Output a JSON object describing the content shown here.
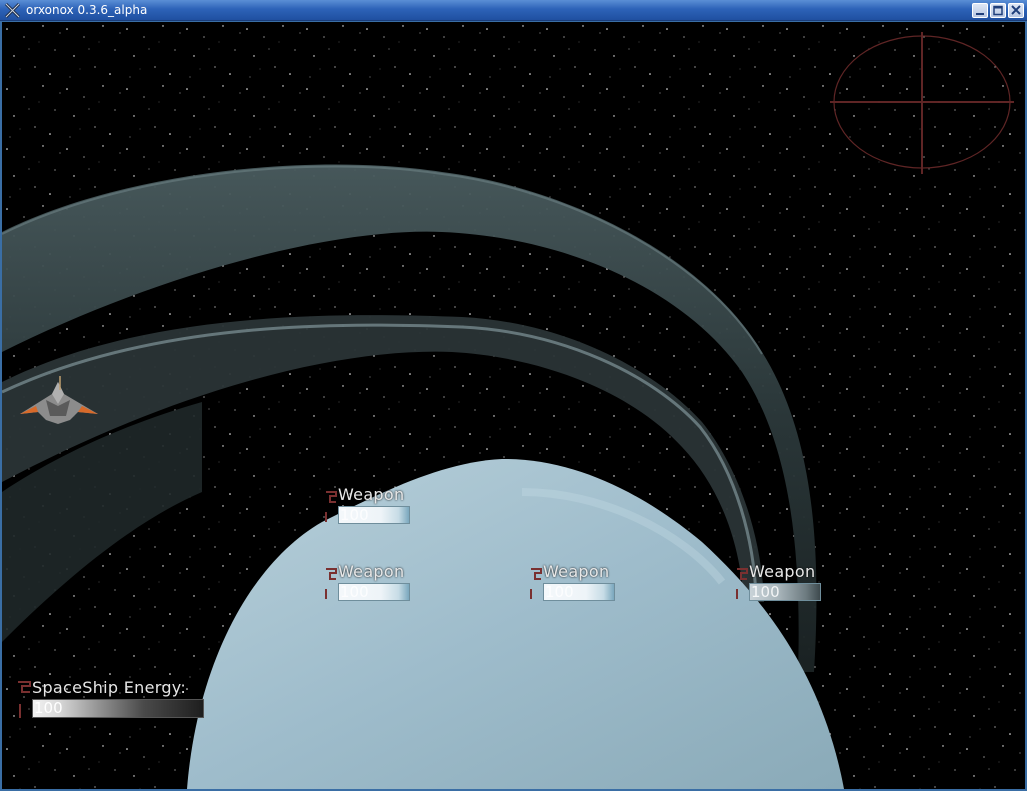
{
  "window": {
    "title": "orxonox 0.3.6_alpha",
    "icon": "orxonox-x-icon",
    "buttons": [
      "minimize-icon",
      "maximize-icon",
      "close-icon"
    ]
  },
  "hud": {
    "weapons": [
      {
        "label": "Weapon",
        "value": "100"
      },
      {
        "label": "Weapon",
        "value": "100"
      },
      {
        "label": "Weapon",
        "value": "100"
      },
      {
        "label": "Weapon",
        "value": "100"
      }
    ],
    "energy": {
      "label": "SpaceShip Energy:",
      "value": "100"
    }
  },
  "colors": {
    "titlebar": "#2d63b8",
    "space": "#000000",
    "planet": "#9fbfcc",
    "ring": "#3b4d50",
    "crosshair": "#6a2a2a"
  }
}
